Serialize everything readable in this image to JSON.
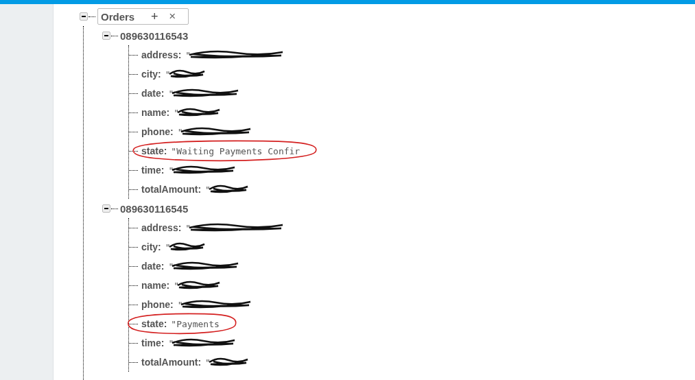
{
  "root": {
    "key": "Orders",
    "expanded": true,
    "actions": [
      "+",
      "×"
    ],
    "children": [
      {
        "key": "089630116543",
        "expanded": true,
        "fields": [
          {
            "name": "address:",
            "value": "\"",
            "redacted": true,
            "circled": false
          },
          {
            "name": "city:",
            "value": "\"",
            "redacted": true,
            "circled": false
          },
          {
            "name": "date:",
            "value": "\"",
            "redacted": true,
            "circled": false
          },
          {
            "name": "name:",
            "value": "\"",
            "redacted": true,
            "circled": false
          },
          {
            "name": "phone:",
            "value": "\"",
            "redacted": true,
            "circled": false
          },
          {
            "name": "state:",
            "value": "\"Waiting Payments Confir",
            "redacted": false,
            "circled": true
          },
          {
            "name": "time:",
            "value": "\"",
            "redacted": true,
            "circled": false
          },
          {
            "name": "totalAmount:",
            "value": "\"",
            "redacted": true,
            "circled": false
          }
        ]
      },
      {
        "key": "089630116545",
        "expanded": true,
        "fields": [
          {
            "name": "address:",
            "value": "\"",
            "redacted": true,
            "circled": false
          },
          {
            "name": "city:",
            "value": "\"",
            "redacted": true,
            "circled": false
          },
          {
            "name": "date:",
            "value": "\"",
            "redacted": true,
            "circled": false
          },
          {
            "name": "name:",
            "value": "\"",
            "redacted": true,
            "circled": false
          },
          {
            "name": "phone:",
            "value": "\"",
            "redacted": true,
            "circled": false
          },
          {
            "name": "state:",
            "value": "\"Payments",
            "redacted": false,
            "circled": true
          },
          {
            "name": "time:",
            "value": "\"",
            "redacted": true,
            "circled": false
          },
          {
            "name": "totalAmount:",
            "value": "\"",
            "redacted": true,
            "circled": false
          }
        ]
      }
    ]
  }
}
